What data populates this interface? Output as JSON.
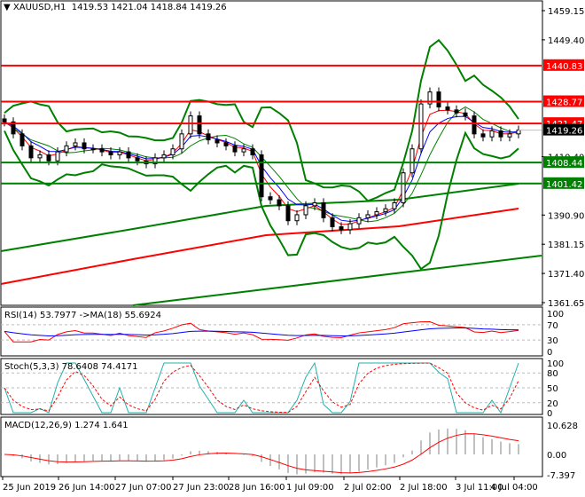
{
  "header": {
    "symbol": "XAUUSD,H1",
    "ohlc": "1419.53 1421.04 1418.84 1419.26"
  },
  "colors": {
    "up": "#000000",
    "down": "#000000",
    "red": "#ff0000",
    "green": "#008000",
    "blue": "#0000ff",
    "teal": "#20b2aa",
    "hist": "#c0c0c0"
  },
  "chart_data": {
    "type": "line",
    "title": "XAUUSD,H1",
    "price_axis": {
      "ylim": [
        1361.65,
        1459.15
      ],
      "ticks": [
        "1459.15",
        "1449.40",
        "1410.40",
        "1390.90",
        "1381.15",
        "1371.40",
        "1361.65"
      ]
    },
    "levels": [
      {
        "label": "1440.83",
        "value": 1440.83,
        "color": "red"
      },
      {
        "label": "1428.77",
        "value": 1428.77,
        "color": "red"
      },
      {
        "label": "1421.47",
        "value": 1421.47,
        "color": "red"
      },
      {
        "label": "1408.44",
        "value": 1408.44,
        "color": "green"
      },
      {
        "label": "1401.42",
        "value": 1401.42,
        "color": "green"
      }
    ],
    "current_price": {
      "label": "1419.26",
      "value": 1419.26
    },
    "x_labels": [
      "25 Jun 2019",
      "26 Jun 14:00",
      "27 Jun 07:00",
      "27 Jun 23:00",
      "28 Jun 16:00",
      "1 Jul 09:00",
      "2 Jul 02:00",
      "2 Jul 18:00",
      "3 Jul 11:00",
      "4 Jul 04:00"
    ],
    "closes": [
      1422,
      1418,
      1414,
      1410,
      1411,
      1409,
      1412,
      1414,
      1415,
      1413,
      1413,
      1412,
      1411,
      1412,
      1410,
      1409,
      1408,
      1410,
      1411,
      1413,
      1418,
      1424,
      1418,
      1416,
      1415,
      1414,
      1412,
      1413,
      1411,
      1397,
      1396,
      1394,
      1389,
      1391,
      1394,
      1395,
      1390,
      1387,
      1386,
      1388,
      1390,
      1391,
      1392,
      1393,
      1395,
      1405,
      1413,
      1428,
      1432,
      1427,
      1426,
      1425,
      1424,
      1418,
      1417,
      1419,
      1417,
      1418,
      1419.26
    ],
    "rsi": {
      "label": "RSI(14) 53.7977  ->MA(18) 55.6924",
      "ticks": [
        "100",
        "70",
        "30",
        "0"
      ]
    },
    "stoch": {
      "label": "Stoch(5,3,3) 78.6408 74.4171",
      "ticks": [
        "100",
        "80",
        "50",
        "20",
        "0"
      ]
    },
    "macd": {
      "label": "MACD(12,26,9) 1.274 1.641",
      "ticks": [
        "10.628",
        "0.00",
        "-7.397"
      ]
    }
  }
}
